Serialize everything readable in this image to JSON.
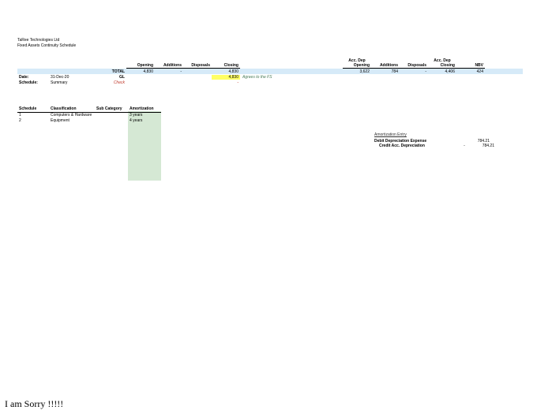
{
  "company": "TaRee Technologies Ltd",
  "report": "Fixed Assets Continuity Schedule",
  "labels": {
    "date": "Date:",
    "schedule": "Schedule:",
    "total": "TOTAL",
    "gl": "GL",
    "check": "Check"
  },
  "meta": {
    "date": "31-Dec-20",
    "schedule": "Summary"
  },
  "cols": {
    "opening": "Opening",
    "additions": "Additions",
    "disposals": "Disposals",
    "closing": "Closing",
    "acc_open": "Acc. Dep Opening",
    "acc_add": "Additions",
    "acc_disp": "Disposals",
    "acc_close": "Acc. Dep Closing",
    "nbv": "NBV"
  },
  "totals": {
    "opening": "4,830",
    "additions": "-",
    "disposals": "",
    "closing": "4,830",
    "acc_open": "3,622",
    "acc_add": "784",
    "acc_disp": "-",
    "acc_close": "4,406",
    "nbv": "424"
  },
  "gl": {
    "closing": "4,830"
  },
  "note": "Agrees to the FS",
  "check": {
    "closing": "-"
  },
  "sched": {
    "h": {
      "schedule": "Schedule",
      "class": "Classification",
      "sub": "Sub Category",
      "amort": "Amortization"
    },
    "rows": [
      {
        "n": "1",
        "class": "Computers & Hardware",
        "sub": "",
        "amort": "3 years"
      },
      {
        "n": "2",
        "class": "Equipment",
        "sub": "",
        "amort": "4 years"
      }
    ]
  },
  "amort": {
    "title": "Amortization Entry",
    "debit_lbl": "Debit Depreciation Expense",
    "credit_lbl": "Credit Acc. Depreciation",
    "debit": "784.21",
    "credit": "784.21",
    "neg": "-"
  },
  "sorry": "I am Sorry !!!!!"
}
